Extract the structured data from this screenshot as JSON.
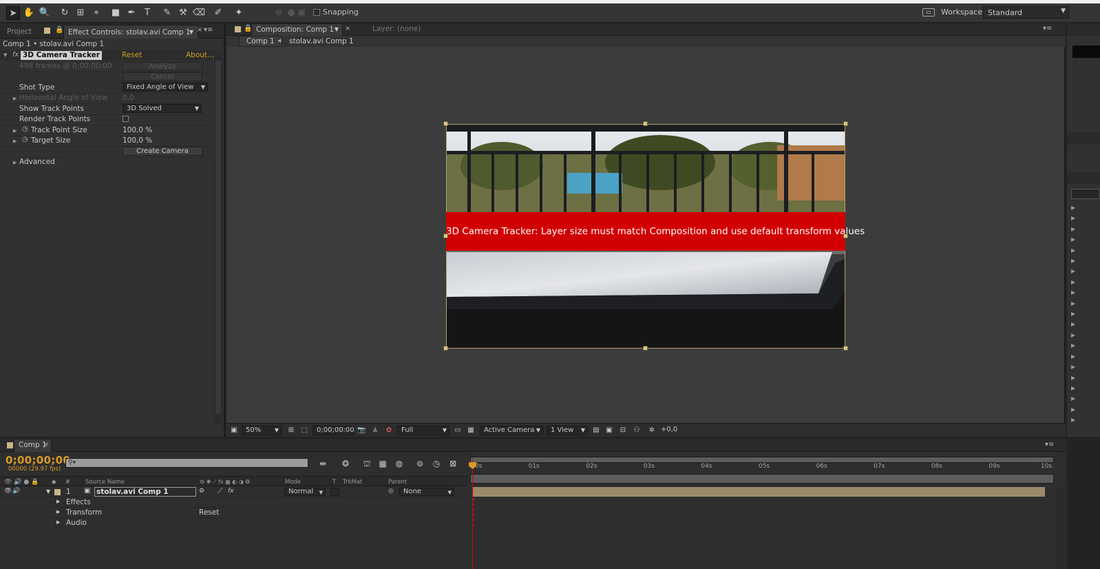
{
  "toolbar": {
    "snapping_label": "Snapping",
    "workspace_label": "Workspace:",
    "workspace_value": "Standard",
    "tools": [
      "selection-tool",
      "hand-tool",
      "zoom-tool",
      "rotation-tool",
      "camera-orbit-tool",
      "pan-behind-tool",
      "rectangle-tool",
      "pen-tool",
      "text-tool",
      "brush-tool",
      "clone-stamp-tool",
      "eraser-tool",
      "roto-brush-tool",
      "puppet-pin-tool"
    ]
  },
  "left_panel": {
    "tabs": {
      "project": "Project",
      "effect_controls": "Effect Controls: stolav.avi Comp 1"
    },
    "breadcrumb": "Comp 1 • stolav.avi Comp 1",
    "effect": {
      "fx_symbol": "fx",
      "name": "3D Camera Tracker",
      "reset": "Reset",
      "about": "About...",
      "status": "498 frames @ 0;00;00;00",
      "analyze_button": "Analyze",
      "cancel_button": "Cancel",
      "shot_type_label": "Shot Type",
      "shot_type_value": "Fixed Angle of View",
      "horizontal_angle_label": "Horizontal Angle of View",
      "horizontal_angle_value": "0,0",
      "show_track_points_label": "Show Track Points",
      "show_track_points_value": "3D Solved",
      "render_track_points_label": "Render Track Points",
      "track_point_size_label": "Track Point Size",
      "track_point_size_value": "100,0 %",
      "target_size_label": "Target Size",
      "target_size_value": "100,0 %",
      "create_camera_button": "Create Camera",
      "advanced_label": "Advanced"
    }
  },
  "comp_panel": {
    "tab_label": "Composition: Comp 1",
    "layer_tab_label": "Layer: (none)",
    "comp_chip": "Comp 1",
    "breadcrumb": "stolav.avi Comp 1",
    "error_message": "3D Camera Tracker: Layer size must match Composition and use default transform values",
    "viewer": {
      "zoom": "50%",
      "timecode": "0;00;00;00",
      "resolution": "Full",
      "camera": "Active Camera",
      "views": "1 View",
      "exposure": "+0,0"
    }
  },
  "timeline": {
    "tab_label": "Comp 1",
    "timecode": "0;00;00;00",
    "fps": "00000 (29.97 fps)",
    "search_placeholder": "⚲▾",
    "columns": {
      "number": "#",
      "source_name": "Source Name",
      "mode": "Mode",
      "t": "T",
      "trkmat": "TrkMat",
      "parent": "Parent"
    },
    "layer": {
      "number": "1",
      "name": "stolav.avi Comp 1",
      "mode": "Normal",
      "parent": "None"
    },
    "sub_rows": {
      "effects": "Effects",
      "transform": "Transform",
      "transform_reset": "Reset",
      "audio": "Audio"
    },
    "ruler_labels": [
      "00s",
      "01s",
      "02s",
      "03s",
      "04s",
      "05s",
      "06s",
      "07s",
      "08s",
      "09s",
      "10s"
    ]
  },
  "colors": {
    "accent": "#d79b25",
    "error_bg": "#d10000",
    "panel_bg": "#313131",
    "viewer_bg": "#3c3c3c"
  }
}
